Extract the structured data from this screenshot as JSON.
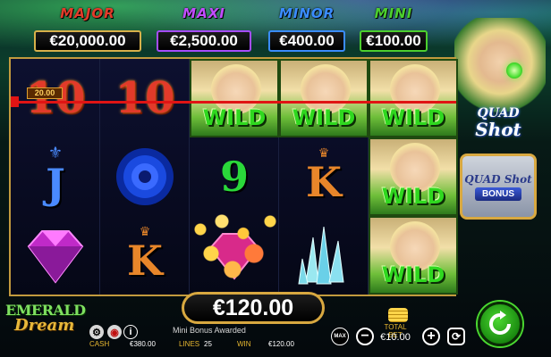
{
  "jackpots": [
    {
      "name": "MAJOR",
      "value": "€20,000.00",
      "name_color": "#e33b2a",
      "border_color": "#d7b04a"
    },
    {
      "name": "MAXI",
      "value": "€2,500.00",
      "name_color": "#c24cff",
      "border_color": "#a64cff"
    },
    {
      "name": "MINOR",
      "value": "€400.00",
      "name_color": "#3a8cff",
      "border_color": "#3a8cff"
    },
    {
      "name": "MINI",
      "value": "€100.00",
      "name_color": "#4ccf2e",
      "border_color": "#4ccf2e"
    }
  ],
  "reels": [
    [
      {
        "type": "number",
        "text": "10"
      },
      {
        "type": "letter",
        "text": "J",
        "color": "#4a8aff",
        "icon": "fleur-de-lis-icon"
      },
      {
        "type": "icon",
        "icon": "pink-diamond-icon",
        "color": "#d83ad8"
      }
    ],
    [
      {
        "type": "number",
        "text": "10"
      },
      {
        "type": "icon",
        "icon": "blue-rose-icon",
        "color": "#2a5aff"
      },
      {
        "type": "letter",
        "text": "K",
        "color": "#e8862a",
        "icon": "crown-icon"
      }
    ],
    [
      {
        "type": "wild",
        "text": "WILD"
      },
      {
        "type": "letter",
        "text": "9",
        "color": "#2ad83a"
      },
      {
        "type": "icon",
        "icon": "gold-coins-icon",
        "color": "#ffd54a"
      }
    ],
    [
      {
        "type": "wild",
        "text": "WILD"
      },
      {
        "type": "letter",
        "text": "K",
        "color": "#e8862a",
        "icon": "crown-icon"
      },
      {
        "type": "icon",
        "icon": "crystal-icon",
        "color": "#7ad8e8"
      }
    ],
    [
      {
        "type": "wild",
        "text": "WILD"
      },
      {
        "type": "wild",
        "text": "WILD"
      },
      {
        "type": "wild",
        "text": "WILD"
      }
    ]
  ],
  "payline": {
    "amount": "20.00",
    "color": "#e01414"
  },
  "side": {
    "logo_line1": "QUAD",
    "logo_line2": "Shot",
    "bonus_top": "QUAD Shot",
    "bonus_label": "BONUS"
  },
  "game_logo": {
    "line1": "EMERALD",
    "line2": "Dream"
  },
  "win": {
    "amount": "€120.00",
    "message": "Mini Bonus Awarded"
  },
  "stats": {
    "cash_label": "CASH",
    "cash_value": "€380.00",
    "lines_label": "LINES",
    "lines_value": "25",
    "win_label": "WIN",
    "win_value": "€120.00"
  },
  "bet": {
    "label": "TOTAL BET",
    "value": "€10.00",
    "max_label": "MAX"
  },
  "controls": {
    "info": "i",
    "minus": "−",
    "plus": "+"
  }
}
